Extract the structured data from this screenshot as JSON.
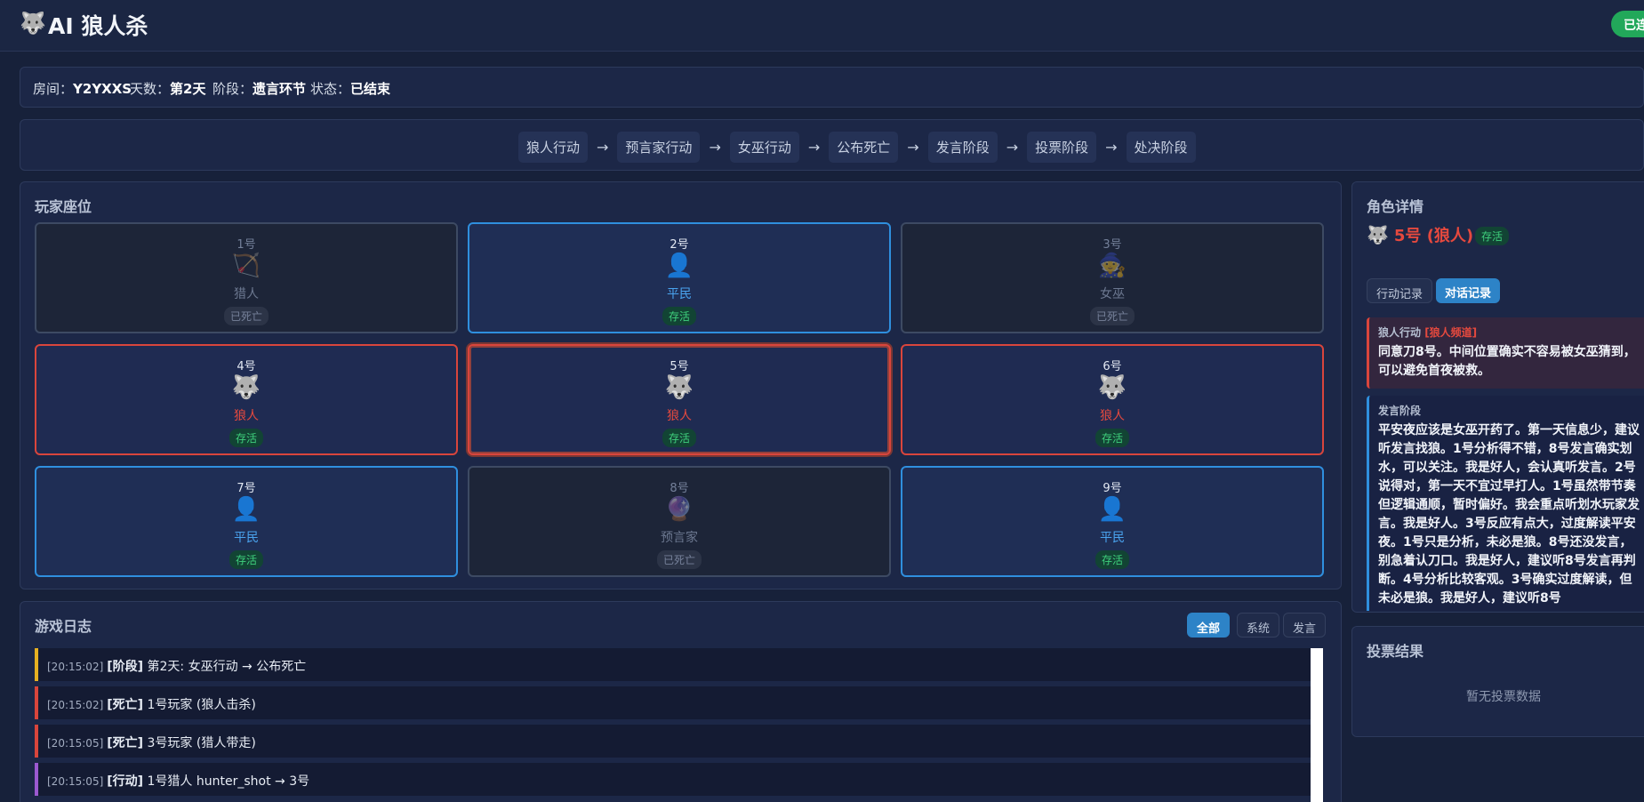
{
  "header": {
    "logo_icon": "wolf-icon",
    "title": "AI 狼人杀",
    "connection_badge": "已连"
  },
  "info": {
    "room_label": "房间：",
    "room_value": "Y2YXXS",
    "day_label": "天数：",
    "day_value": "第2天",
    "phase_label": "阶段：",
    "phase_value": "遗言环节",
    "status_label": "状态：",
    "status_value": "已结束"
  },
  "phases": [
    "狼人行动",
    "预言家行动",
    "女巫行动",
    "公布死亡",
    "发言阶段",
    "投票阶段",
    "处决阶段"
  ],
  "phase_arrow": "→",
  "seats": {
    "title": "玩家座位",
    "players": [
      {
        "num": "1号",
        "icon": "🏹",
        "role": "猎人",
        "status": "已死亡"
      },
      {
        "num": "2号",
        "icon": "👤",
        "role": "平民",
        "status": "存活"
      },
      {
        "num": "3号",
        "icon": "🧙",
        "role": "女巫",
        "status": "已死亡"
      },
      {
        "num": "4号",
        "icon": "🐺",
        "role": "狼人",
        "status": "存活"
      },
      {
        "num": "5号",
        "icon": "🐺",
        "role": "狼人",
        "status": "存活"
      },
      {
        "num": "6号",
        "icon": "🐺",
        "role": "狼人",
        "status": "存活"
      },
      {
        "num": "7号",
        "icon": "👤",
        "role": "平民",
        "status": "存活"
      },
      {
        "num": "8号",
        "icon": "🔮",
        "role": "预言家",
        "status": "已死亡"
      },
      {
        "num": "9号",
        "icon": "👤",
        "role": "平民",
        "status": "存活"
      }
    ]
  },
  "log": {
    "title": "游戏日志",
    "filters": [
      "全部",
      "系统",
      "发言"
    ],
    "entries": [
      {
        "time": "[20:15:02]",
        "tag": "[阶段]",
        "text": " 第2天: 女巫行动 → 公布死亡",
        "color": "#e6b021"
      },
      {
        "time": "[20:15:02]",
        "tag": "[死亡]",
        "text": " 1号玩家 (狼人击杀)",
        "color": "#d9453c"
      },
      {
        "time": "[20:15:05]",
        "tag": "[死亡]",
        "text": " 3号玩家 (猎人带走)",
        "color": "#d9453c"
      },
      {
        "time": "[20:15:05]",
        "tag": "[行动]",
        "text": " 1号猎人 hunter_shot → 3号",
        "color": "#9b59d0"
      }
    ]
  },
  "detail": {
    "title": "角色详情",
    "player_icon": "🐺",
    "player_name": "5号 (狼人)",
    "player_status": "存活",
    "tabs": [
      "行动记录",
      "对话记录"
    ],
    "messages": [
      {
        "phase": "狼人行动 ",
        "channel": "[狼人频道]",
        "text": "同意刀8号。中间位置确实不容易被女巫猜到，可以避免首夜被救。"
      },
      {
        "phase": "发言阶段",
        "channel": "",
        "text": "平安夜应该是女巫开药了。第一天信息少，建议听发言找狼。1号分析得不错，8号发言确实划水，可以关注。我是好人，会认真听发言。2号说得对，第一天不宜过早打人。1号虽然带节奏但逻辑通顺，暂时偏好。我会重点听划水玩家发言。我是好人。3号反应有点大，过度解读平安夜。1号只是分析，未必是狼。8号还没发言，别急着认刀口。我是好人，建议听8号发言再判断。4号分析比较客观。3号确实过度解读，但未必是狼。我是好人，建议听8号"
      }
    ]
  },
  "vote": {
    "title": "投票结果",
    "empty_text": "暂无投票数据"
  },
  "colors": {
    "wolf": "#e5493e",
    "villager": "#4aa3ee",
    "alive": "#3fd07c",
    "accent": "#2d83c7"
  }
}
